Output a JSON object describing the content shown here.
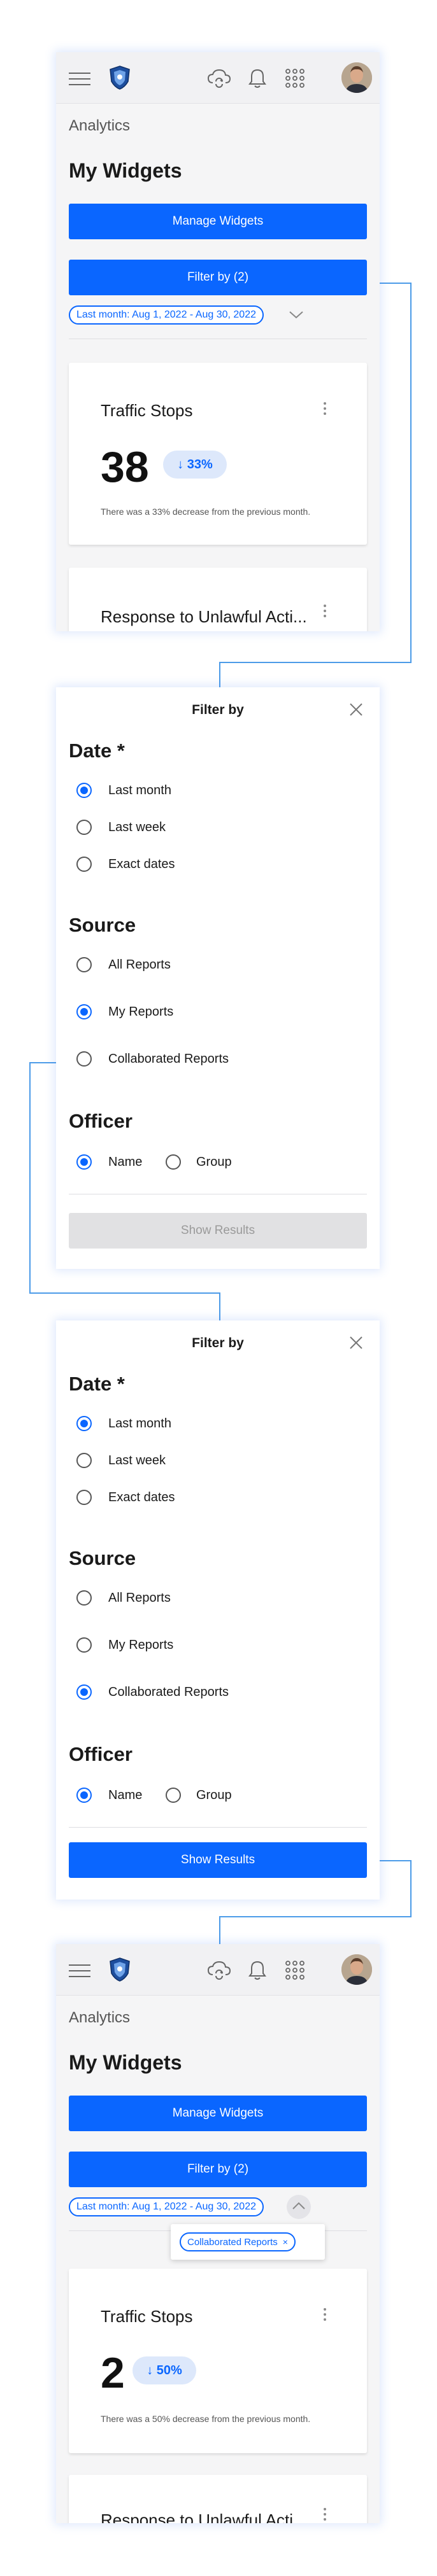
{
  "header": {
    "menu_icon": "hamburger-menu-icon",
    "logo_icon": "shield-badge-logo",
    "icons": [
      "cloud-sync-icon",
      "bell-icon",
      "app-grid-icon"
    ],
    "avatar": "user-avatar"
  },
  "dashboard": {
    "breadcrumb": "Analytics",
    "title": "My Widgets",
    "manage_button": "Manage Widgets",
    "filter_button": "Filter by (2)",
    "date_chip": "Last month: Aug 1, 2022 - Aug 30, 2022"
  },
  "screen1": {
    "card1": {
      "title": "Traffic Stops",
      "value": "38",
      "badge": "↓ 33%",
      "description": "There was a 33% decrease from the previous month."
    },
    "card2": {
      "title": "Response to Unlawful Acti..."
    }
  },
  "modal": {
    "title": "Filter by",
    "date_heading": "Date *",
    "date_options": [
      "Last month",
      "Last week",
      "Exact dates"
    ],
    "source_heading": "Source",
    "source_options": [
      "All Reports",
      "My Reports",
      "Collaborated Reports"
    ],
    "officer_heading": "Officer",
    "officer_options": [
      "Name",
      "Group"
    ],
    "show_results": "Show Results"
  },
  "modal_a": {
    "date_selected": "Last month",
    "source_selected": "My Reports",
    "officer_selected": "Name",
    "show_results_enabled": false
  },
  "modal_b": {
    "date_selected": "Last month",
    "source_selected": "Collaborated Reports",
    "officer_selected": "Name",
    "show_results_enabled": true
  },
  "screen4": {
    "popover_chip": "Collaborated Reports",
    "card1": {
      "title": "Traffic Stops",
      "value": "2",
      "badge": "↓ 50%",
      "description": "There was a 50% decrease from the previous month."
    },
    "card2": {
      "title": "Response to Unlawful Acti..."
    }
  },
  "colors": {
    "accent": "#0a66ff",
    "connector": "#4c9be8",
    "badge_bg": "#dde8fb",
    "disabled": "#e1e1e3"
  }
}
